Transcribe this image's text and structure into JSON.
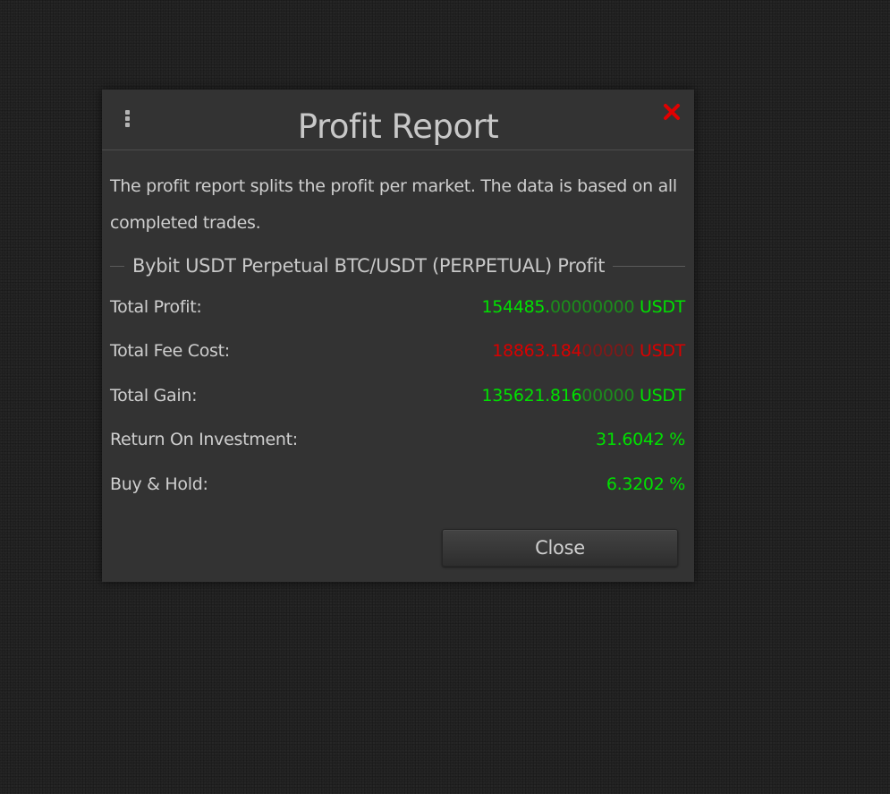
{
  "dialog": {
    "title": "Profit Report",
    "menu_icon": "vertical-ellipsis-icon",
    "close_icon": "close-x-icon",
    "close_icon_color": "#e00000",
    "description": "The profit report splits the profit per market. The data is based on all completed trades.",
    "section_title": "Bybit USDT Perpetual BTC/USDT (PERPETUAL) Profit",
    "rows": [
      {
        "label": "Total Profit:",
        "value_main": "154485.",
        "value_faded": "00000000",
        "unit": " USDT",
        "tone": "green"
      },
      {
        "label": "Total Fee Cost:",
        "value_main": "18863.184",
        "value_faded": "00000",
        "unit": " USDT",
        "tone": "red"
      },
      {
        "label": "Total Gain:",
        "value_main": "135621.816",
        "value_faded": "00000",
        "unit": " USDT",
        "tone": "green"
      },
      {
        "label": "Return On Investment:",
        "value_main": "31.6042 %",
        "value_faded": "",
        "unit": "",
        "tone": "green"
      },
      {
        "label": "Buy & Hold:",
        "value_main": "6.3202 %",
        "value_faded": "",
        "unit": "",
        "tone": "green"
      }
    ],
    "close_button_label": "Close"
  },
  "colors": {
    "positive": "#00e000",
    "positive_faded": "#1c8c1c",
    "negative": "#d90000",
    "negative_faded": "#801818"
  }
}
